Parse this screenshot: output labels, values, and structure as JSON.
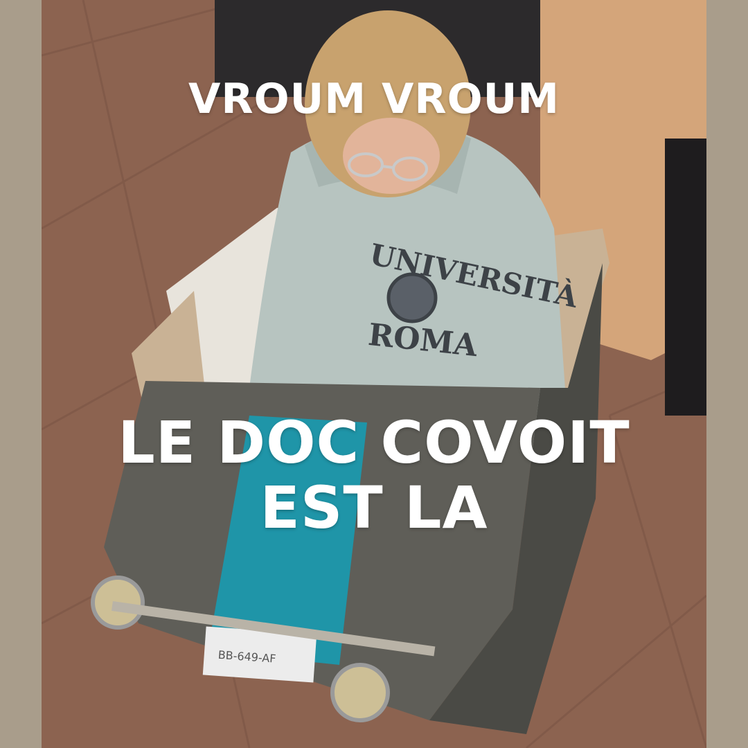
{
  "captions": {
    "top": "VROUM VROUM",
    "main_line1": "LE DOC COVOIT",
    "main_line2": "EST LA"
  },
  "photo": {
    "sweatshirt_text_top": "UNIVERSITÀ",
    "sweatshirt_text_bottom": "ROMA",
    "plate": "BB-649-AF"
  },
  "colors": {
    "border": "#a99d8b",
    "box_gray": "#5f5e58",
    "stripe_teal": "#1f95a8",
    "hoodie": "#b7c4c0",
    "floor": "#8c6350",
    "caption": "#ffffff"
  }
}
